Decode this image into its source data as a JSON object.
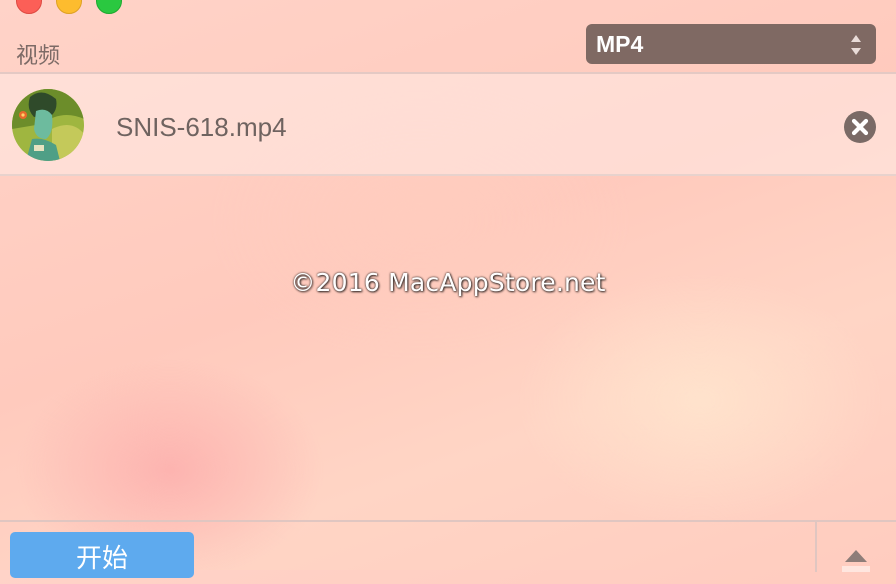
{
  "window": {
    "controls": [
      "close",
      "minimize",
      "zoom"
    ]
  },
  "header": {
    "section_label": "视频"
  },
  "format_select": {
    "value": "MP4",
    "icon": "up-down-arrows-icon"
  },
  "files": [
    {
      "name": "SNIS-618.mp4",
      "thumbnail_icon": "video-thumbnail",
      "remove_icon": "close-circle-icon"
    }
  ],
  "watermark": "©2016 MacAppStore.net",
  "footer": {
    "start_label": "开始",
    "expand_icon": "triangle-up-icon"
  },
  "colors": {
    "select_bg": "#7f6963",
    "start_button": "#5eaaee",
    "remove_icon": "#7a6a66"
  }
}
